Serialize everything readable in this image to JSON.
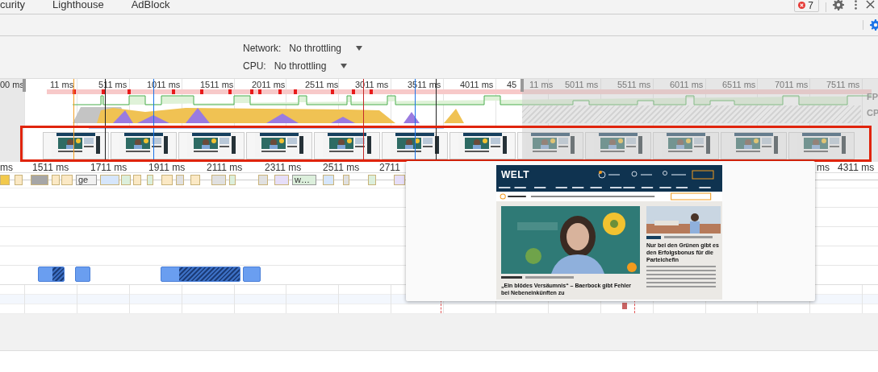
{
  "tabs": [
    {
      "label": "curity",
      "selected": false
    },
    {
      "label": "Lighthouse",
      "selected": false
    },
    {
      "label": "AdBlock",
      "selected": false
    }
  ],
  "error_badge": {
    "count": "7"
  },
  "throttling": [
    {
      "label": "Network:",
      "value": "No throttling"
    },
    {
      "label": "CPU:",
      "value": "No throttling"
    }
  ],
  "overview": {
    "ticks": [
      "00 ms",
      "11 ms",
      "511 ms",
      "1011 ms",
      "1511 ms",
      "2011 ms",
      "2511 ms",
      "3011 ms",
      "3511 ms",
      "4011 ms",
      "45",
      "11 ms",
      "5011 ms",
      "5511 ms",
      "6011 ms",
      "6511 ms",
      "7011 ms",
      "7511 ms"
    ],
    "track_labels": [
      "FP",
      "CP"
    ]
  },
  "ruler": {
    "ticks": [
      "ms",
      "1511 ms",
      "1711 ms",
      "1911 ms",
      "2111 ms",
      "2311 ms",
      "2511 ms",
      "2711",
      "ms",
      "4311 ms"
    ]
  },
  "flame_labels": [
    "ge",
    "w…"
  ],
  "tooltip": {
    "logo": "WELT",
    "headline": "„Ein blödes Versäumnis“ – Baerbock gibt Fehler bei Nebeneinkünften zu",
    "side_headline": "Nur bei den Grünen gibt es den Erfolgsbonus für die Parteichefin"
  }
}
